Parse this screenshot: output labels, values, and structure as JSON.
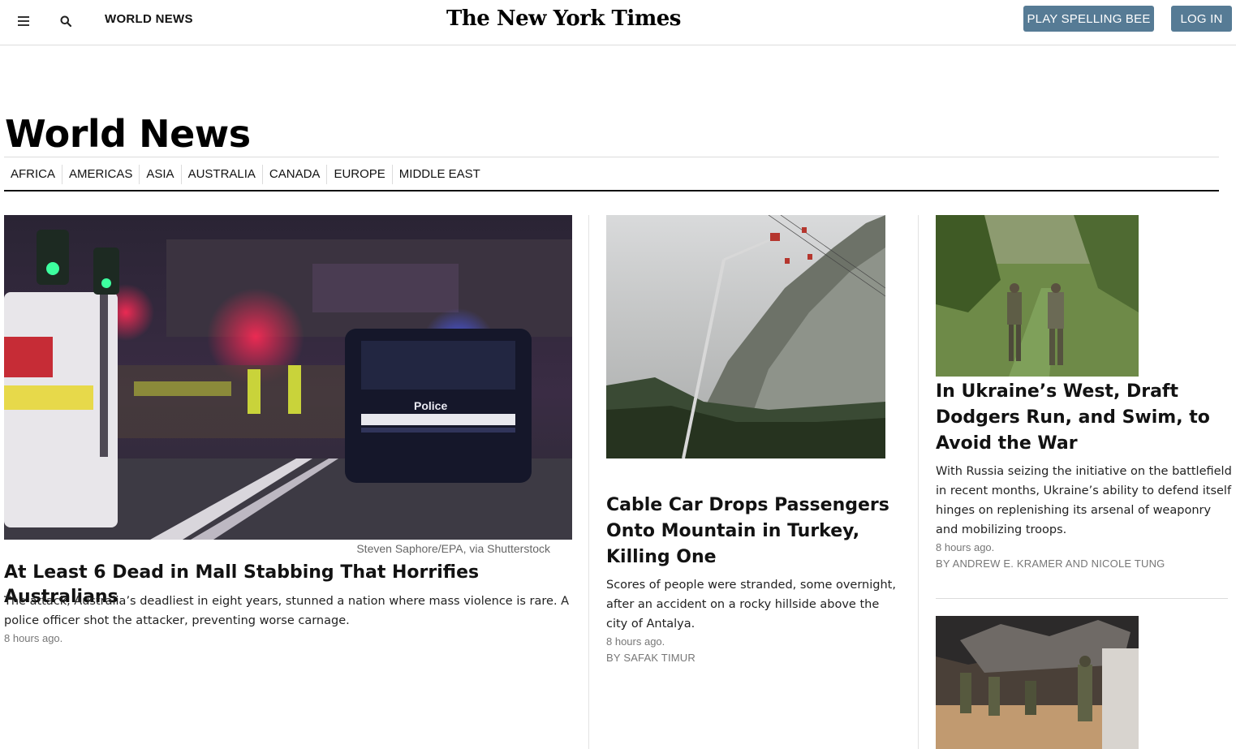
{
  "header": {
    "section_label": "WORLD NEWS",
    "masthead": "The New York Times",
    "play_button": "PLAY SPELLING BEE",
    "login_button": "LOG IN",
    "menu_icon": "hamburger-menu-icon",
    "search_icon": "search-icon"
  },
  "page": {
    "title": "World News",
    "subnav": [
      "AFRICA",
      "AMERICAS",
      "ASIA",
      "AUSTRALIA",
      "CANADA",
      "EUROPE",
      "MIDDLE EAST"
    ]
  },
  "stories": {
    "lead": {
      "caption": "Steven Saphore/EPA, via Shutterstock",
      "headline": "At Least 6 Dead in Mall Stabbing That Horrifies Australians",
      "summary": "The attack, Australia’s deadliest in eight years, stunned a nation where mass violence is rare. A police officer shot the attacker, preventing worse carnage.",
      "time": "8 hours ago."
    },
    "second": {
      "headline": "Cable Car Drops Passengers Onto Mountain in Turkey, Killing One",
      "summary": "Scores of people were stranded, some overnight, after an accident on a rocky hillside above the city of Antalya.",
      "time": "8 hours ago.",
      "byline": "BY SAFAK TIMUR"
    },
    "third": {
      "headline": "In Ukraine’s West, Draft Dodgers Run, and Swim, to Avoid the War",
      "summary": "With Russia seizing the initiative on the battlefield in recent months, Ukraine’s ability to defend itself hinges on replenishing its arsenal of weaponry and mobilizing troops.",
      "time": "8 hours ago.",
      "byline": "BY ANDREW E. KRAMER AND NICOLE TUNG"
    }
  },
  "colors": {
    "button": "#567b95",
    "text": "#121212",
    "muted": "#777777"
  }
}
